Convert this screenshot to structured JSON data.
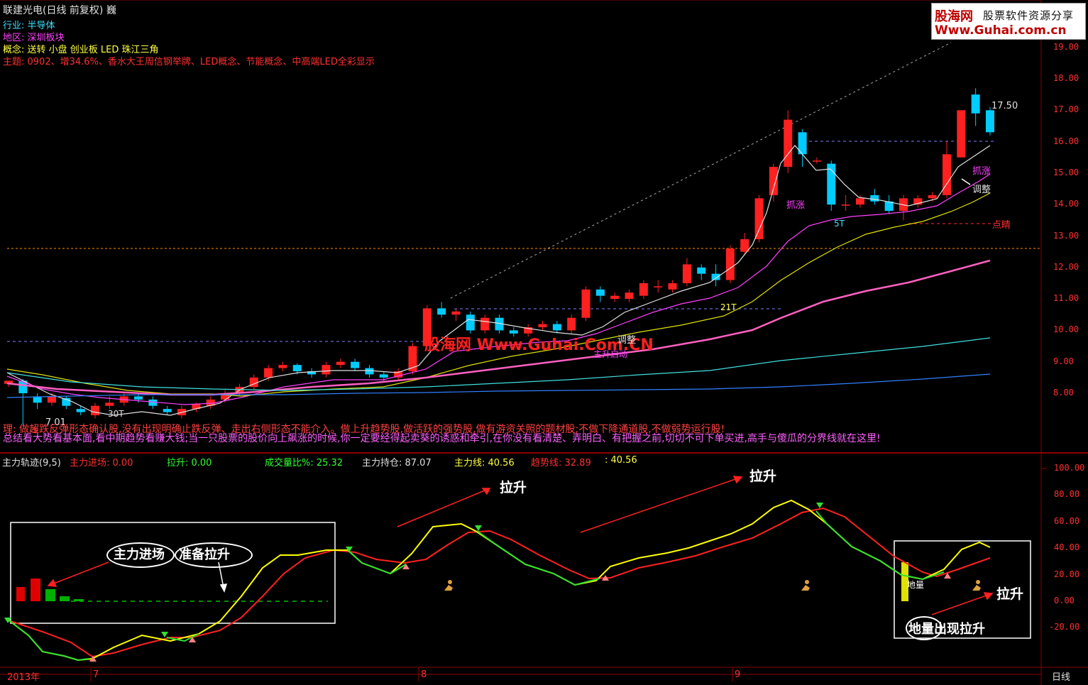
{
  "window": {
    "title": "联建光电(日线 前复权) 巍"
  },
  "info": {
    "industry": "行业: 半导体",
    "region": "地区: 深圳板块",
    "concept": "概念: 送转 小盘 创业板 LED 珠江三角",
    "theme": "主题: 0902、增34.6%、香水大王周信钢举牌、LED概念、节能概念、中高端LED全彩显示"
  },
  "logo": {
    "name": "股海网",
    "slogan": "股票软件资源分享",
    "url": "Www.Guhai.com.cn"
  },
  "watermark": "股海网 Www.Guhai.Com.CN",
  "price_axis": [
    "19.00",
    "18.00",
    "17.00",
    "16.00",
    "15.00",
    "14.00",
    "13.00",
    "12.00",
    "11.00",
    "10.00",
    "9.00",
    "8.00"
  ],
  "main_labels": {
    "price_1750": "17.50",
    "price_701": "7.01",
    "zhuazhang1": "抓涨",
    "zhuazhang2": "抓涨",
    "tiaozheng1": "调整",
    "tiaozheng2": "调整",
    "dianjing": "点睛",
    "t5": "5T",
    "t21": "21T",
    "t30": "30T",
    "qijiqiandong": "主升启动",
    "s_mark": "$"
  },
  "notes": {
    "line1": "理: 做超跌反弹形态确认股,没有出现明确止跌反弹、走出右侧形态不能介入。做上升趋势股,做活跃的强势股,做有游资关照的题材股;不做下降通道股,不做弱势运行股!",
    "line2": "总结看大势看基本面,看中期趋势看赚大钱;当一只股票的股价向上飙涨的时候,你一定要经得起卖葵的诱惑和牵引,在你没有看清楚、弄明白、有把握之前,切切不可下单买进,高手与傻瓜的分界线就在这里!"
  },
  "indicator": {
    "name": "主力轨迹(9,5)",
    "zljc": "主力进场: 0.00",
    "ls": "拉升: 0.00",
    "cjlb": "成交量比%: 25.32",
    "zlcc": "主力持仓: 87.07",
    "zlx": "主力线: 40.56",
    "qsx": "趋势线: 32.89",
    "extra": ": 40.56",
    "axis": [
      "100.00",
      "80.00",
      "60.00",
      "40.00",
      "20.00",
      "0.00",
      "-20.00"
    ]
  },
  "annotations": {
    "lasheng1": "拉升",
    "lasheng2": "拉升",
    "lasheng3": "拉升",
    "zljc": "主力进场",
    "zbls": "准备拉升",
    "diliang": "地量出现拉升",
    "diliang_small": "地量"
  },
  "time_axis": {
    "year": "2013年",
    "m7": "7",
    "m8": "8",
    "m9": "9",
    "period": "日线"
  },
  "colors": {
    "up": "#ff2020",
    "down": "#00ccff",
    "yellow": "#ffff00",
    "grid": "#8b0000"
  },
  "chart_data": {
    "type": "candlestick",
    "ylim": [
      7,
      19.5
    ],
    "candles": [
      [
        8.3,
        8.4,
        8.2,
        8.3
      ],
      [
        8.4,
        8.0,
        8.45,
        7.0
      ],
      [
        7.9,
        7.7,
        8.0,
        7.5
      ],
      [
        7.7,
        7.9,
        8.0,
        7.6
      ],
      [
        7.85,
        7.6,
        7.9,
        7.5
      ],
      [
        7.5,
        7.4,
        7.6,
        7.3
      ],
      [
        7.3,
        7.6,
        7.7,
        7.2
      ],
      [
        7.6,
        7.7,
        7.9,
        7.5
      ],
      [
        7.7,
        7.9,
        8.0,
        7.6
      ],
      [
        7.9,
        7.8,
        8.0,
        7.7
      ],
      [
        7.8,
        7.6,
        7.9,
        7.5
      ],
      [
        7.5,
        7.4,
        7.6,
        7.3
      ],
      [
        7.3,
        7.5,
        7.6,
        7.2
      ],
      [
        7.5,
        7.65,
        7.7,
        7.4
      ],
      [
        7.6,
        7.8,
        7.9,
        7.5
      ],
      [
        7.8,
        8.0,
        8.1,
        7.7
      ],
      [
        8.0,
        8.2,
        8.3,
        7.9
      ],
      [
        8.2,
        8.5,
        8.6,
        8.1
      ],
      [
        8.5,
        8.8,
        8.9,
        8.4
      ],
      [
        8.8,
        8.9,
        9.0,
        8.7
      ],
      [
        8.9,
        8.7,
        8.95,
        8.6
      ],
      [
        8.7,
        8.6,
        8.8,
        8.5
      ],
      [
        8.6,
        8.9,
        9.0,
        8.5
      ],
      [
        8.9,
        9.0,
        9.1,
        8.8
      ],
      [
        9.0,
        8.8,
        9.1,
        8.7
      ],
      [
        8.8,
        8.6,
        8.9,
        8.5
      ],
      [
        8.6,
        8.5,
        8.7,
        8.4
      ],
      [
        8.5,
        8.7,
        8.8,
        8.4
      ],
      [
        8.7,
        9.5,
        9.6,
        8.6
      ],
      [
        9.5,
        10.7,
        10.8,
        9.4
      ],
      [
        10.7,
        10.5,
        10.9,
        10.4
      ],
      [
        10.5,
        10.6,
        10.7,
        10.3
      ],
      [
        10.5,
        10.0,
        10.6,
        9.9
      ],
      [
        10.0,
        10.4,
        10.5,
        9.9
      ],
      [
        10.4,
        10.0,
        10.5,
        9.9
      ],
      [
        10.0,
        9.9,
        10.1,
        9.8
      ],
      [
        9.9,
        10.1,
        10.2,
        9.8
      ],
      [
        10.1,
        10.2,
        10.3,
        10.0
      ],
      [
        10.2,
        10.0,
        10.3,
        9.9
      ],
      [
        10.0,
        10.4,
        10.5,
        9.9
      ],
      [
        10.4,
        11.3,
        11.4,
        10.3
      ],
      [
        11.3,
        11.1,
        11.4,
        10.9
      ],
      [
        11.0,
        11.1,
        11.2,
        10.9
      ],
      [
        11.0,
        11.2,
        11.3,
        10.9
      ],
      [
        11.1,
        11.5,
        11.6,
        11.0
      ],
      [
        11.4,
        11.4,
        11.6,
        11.2
      ],
      [
        11.3,
        11.5,
        11.6,
        11.2
      ],
      [
        11.5,
        12.1,
        12.3,
        11.4
      ],
      [
        12.0,
        11.8,
        12.1,
        11.6
      ],
      [
        11.8,
        11.6,
        12.1,
        11.4
      ],
      [
        11.6,
        12.6,
        12.7,
        11.5
      ],
      [
        12.5,
        12.9,
        13.1,
        12.4
      ],
      [
        12.9,
        14.2,
        14.3,
        12.8
      ],
      [
        14.3,
        15.2,
        15.3,
        14.1
      ],
      [
        15.2,
        16.7,
        17.0,
        15.0
      ],
      [
        16.3,
        15.6,
        16.4,
        15.2
      ],
      [
        15.4,
        15.4,
        15.5,
        15.3
      ],
      [
        15.3,
        14.0,
        15.4,
        13.8
      ],
      [
        14.0,
        14.0,
        14.3,
        13.8
      ],
      [
        14.0,
        14.2,
        14.3,
        13.9
      ],
      [
        14.3,
        14.1,
        14.5,
        14.0
      ],
      [
        14.1,
        13.8,
        14.3,
        13.7
      ],
      [
        13.8,
        14.2,
        14.3,
        13.5
      ],
      [
        14.0,
        14.2,
        14.3,
        13.9
      ],
      [
        14.2,
        14.3,
        14.4,
        14.1
      ],
      [
        14.3,
        15.6,
        16.0,
        14.2
      ],
      [
        15.5,
        17.0,
        17.0,
        15.5
      ],
      [
        17.5,
        16.9,
        17.7,
        16.5
      ],
      [
        17.0,
        16.3,
        17.1,
        16.2
      ]
    ]
  }
}
